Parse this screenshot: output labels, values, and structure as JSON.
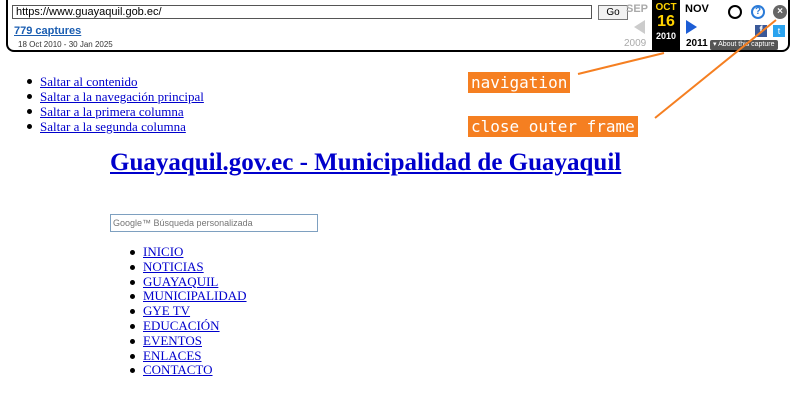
{
  "toolbar": {
    "url": "https://www.guayaquil.gob.ec/",
    "go_label": "Go",
    "captures_label": "779 captures",
    "date_range": "18 Oct 2010 - 30 Jan 2025",
    "prev_month": "SEP",
    "current_month": "OCT",
    "next_month": "NOV",
    "current_day": "16",
    "prev_year": "2009",
    "current_year": "2010",
    "next_year": "2011",
    "help_glyph": "?",
    "close_glyph": "×",
    "facebook_glyph": "f",
    "twitter_glyph": "t",
    "about_label": "▾ About this capture"
  },
  "skip_links": [
    "Saltar al contenido",
    "Saltar a la navegación principal",
    "Saltar a la primera columna",
    "Saltar a la segunda columna"
  ],
  "page_title": "Guayaquil.gov.ec - Municipalidad de Guayaquil",
  "search": {
    "placeholder": "Google™ Búsqueda personalizada"
  },
  "nav": [
    "INICIO",
    "NOTICIAS",
    "GUAYAQUIL",
    "MUNICIPALIDAD",
    "GYE TV",
    "EDUCACIÓN",
    "EVENTOS",
    "ENLACES",
    "CONTACTO"
  ],
  "annotations": {
    "navigation": "navigation",
    "close_outer_frame": "close outer frame"
  },
  "colors": {
    "annotation": "#f57f21",
    "link": "#0000cc",
    "current_date_bg": "#000000",
    "current_date_fg": "#ffd200"
  }
}
